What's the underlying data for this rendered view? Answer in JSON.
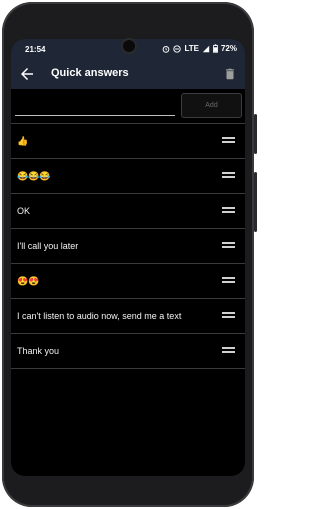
{
  "status": {
    "time": "21:54",
    "network": "LTE",
    "battery": "72%"
  },
  "toolbar": {
    "title": "Quick answers"
  },
  "input": {
    "value": "",
    "add_label": "Add"
  },
  "answers": [
    {
      "text": "👍"
    },
    {
      "text": "😂😂😂"
    },
    {
      "text": "OK"
    },
    {
      "text": "I'll call you later"
    },
    {
      "text": "😍😍"
    },
    {
      "text": "I can't listen to audio now, send me a text"
    },
    {
      "text": "Thank you"
    }
  ],
  "colors": {
    "toolbar_bg": "#1f2736",
    "screen_bg": "#000000",
    "divider": "#3a3a3a"
  }
}
